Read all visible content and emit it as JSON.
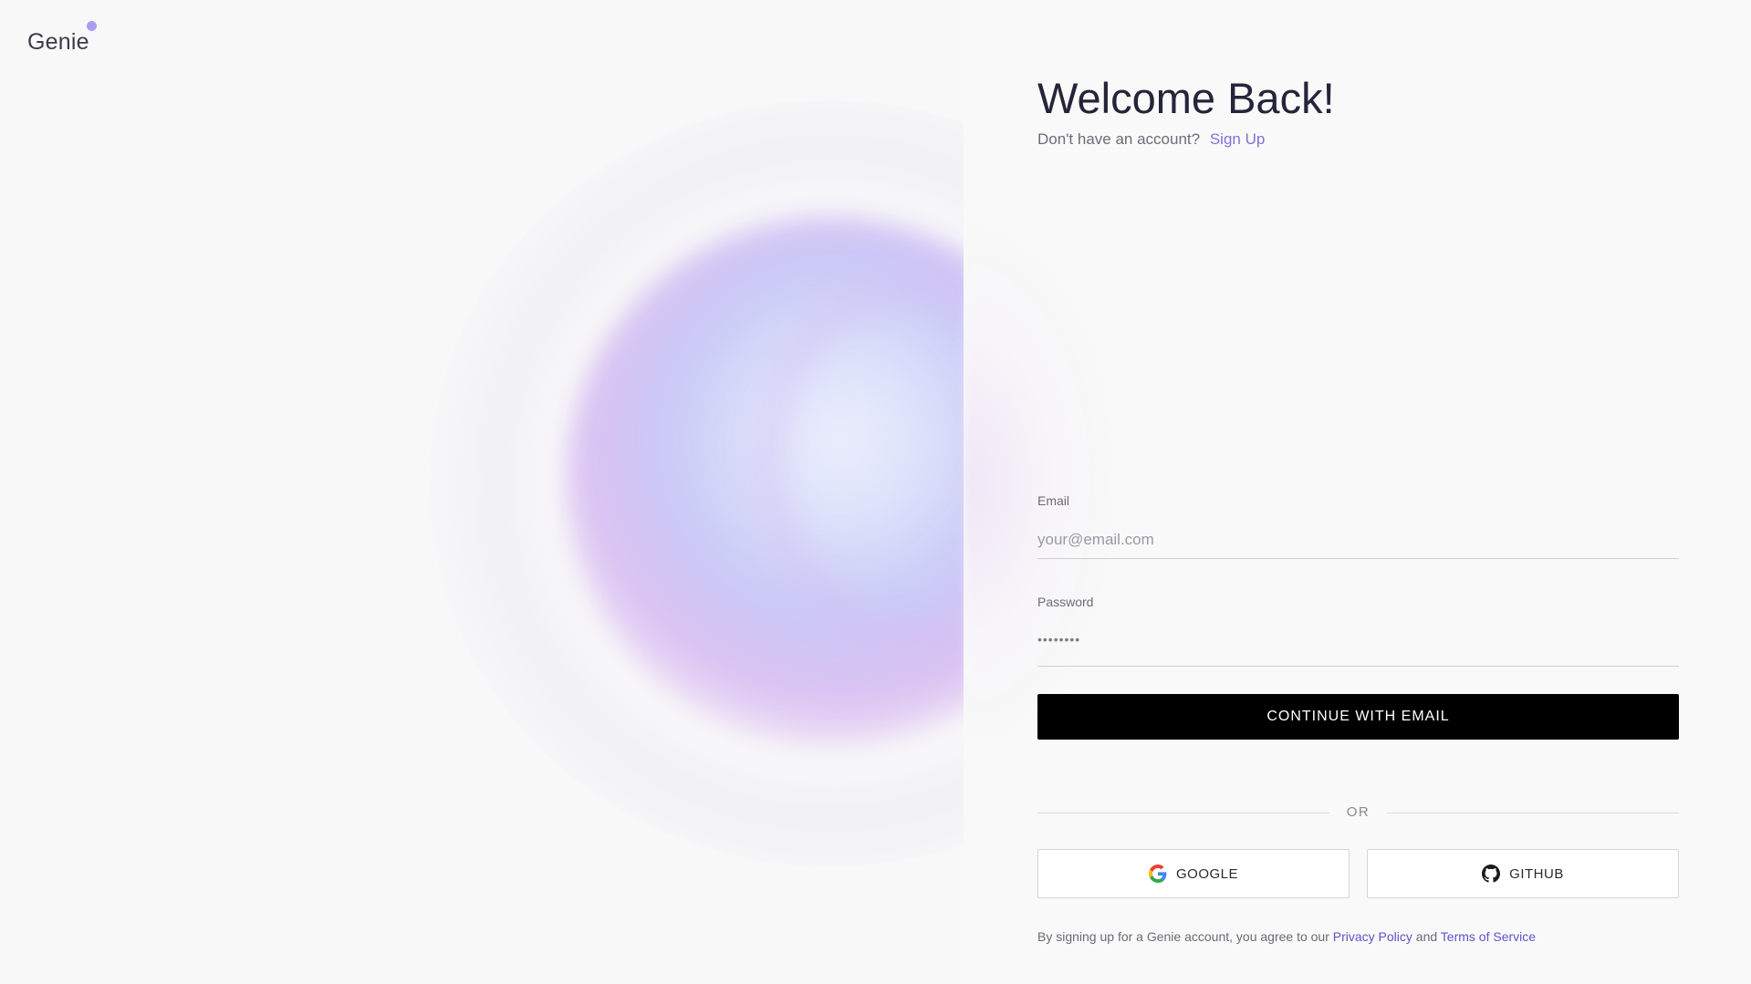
{
  "brand": {
    "name": "Genie",
    "accent_color": "#a99ff0"
  },
  "heading": {
    "title": "Welcome Back!",
    "prompt": "Don't have an account?",
    "signup_link": "Sign Up"
  },
  "form": {
    "email_label": "Email",
    "email_placeholder": "your@email.com",
    "password_label": "Password",
    "password_value": "••••••••",
    "submit_label": "CONTINUE WITH EMAIL"
  },
  "divider": {
    "label": "OR"
  },
  "social": {
    "google_label": "GOOGLE",
    "github_label": "GITHUB"
  },
  "legal": {
    "prefix": "By signing up for a Genie account, you agree to our",
    "privacy_link": "Privacy Policy",
    "conjunction": "and",
    "terms_link": "Terms of Service"
  },
  "colors": {
    "primary_button": "#000000",
    "link": "#7d74d6"
  }
}
